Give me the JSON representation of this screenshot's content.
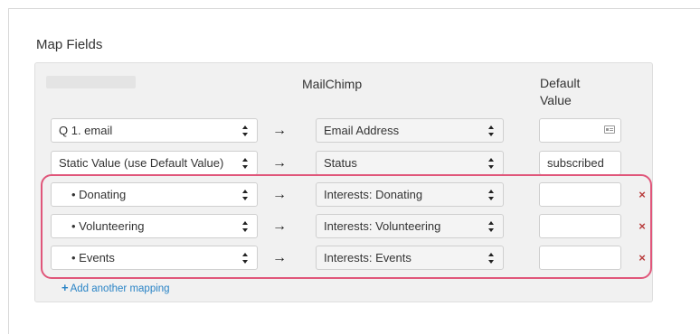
{
  "section": {
    "title": "Map Fields"
  },
  "columns": {
    "mailchimp": "MailChimp",
    "default_value": "Default Value"
  },
  "rows": [
    {
      "source": "Q 1. email",
      "arrow": "→",
      "target": "Email Address",
      "default": "",
      "default_icon": "contact-card-icon",
      "removable": false
    },
    {
      "source": "Static Value (use Default Value)",
      "arrow": "→",
      "target": "Status",
      "default": "subscribed",
      "removable": false
    },
    {
      "source": "• Donating",
      "arrow": "→",
      "target": "Interests: Donating",
      "default": "",
      "removable": true,
      "remove_label": "×"
    },
    {
      "source": "• Volunteering",
      "arrow": "→",
      "target": "Interests: Volunteering",
      "default": "",
      "removable": true,
      "remove_label": "×"
    },
    {
      "source": "• Events",
      "arrow": "→",
      "target": "Interests: Events",
      "default": "",
      "removable": true,
      "remove_label": "×"
    }
  ],
  "add_mapping": {
    "icon": "+",
    "label": "Add another mapping"
  },
  "colors": {
    "highlight": "#e0567a",
    "link": "#2a84c6",
    "remove": "#b83c3c"
  }
}
